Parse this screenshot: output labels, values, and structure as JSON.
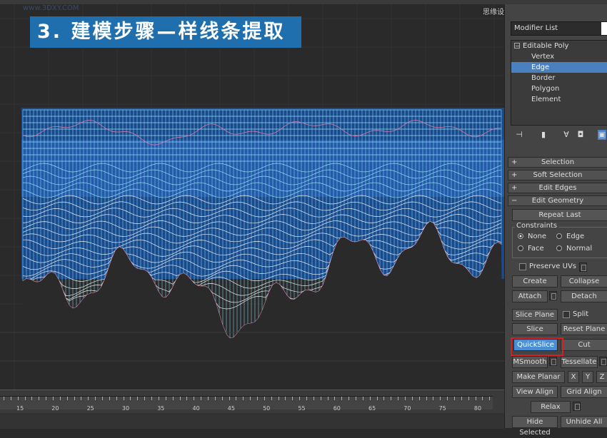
{
  "title_banner": "3. 建模步骤—样线条提取",
  "watermark_left": "www.3DXY.COM",
  "watermark_right": "思缘设计论坛 www.MISSYUAN.COM",
  "timeline": {
    "labels": [
      "15",
      "20",
      "25",
      "30",
      "35",
      "40",
      "45",
      "50",
      "55",
      "60",
      "65",
      "70",
      "75",
      "80"
    ]
  },
  "panel": {
    "modifier_list": "Modifier List",
    "stack": {
      "editable_poly": "Editable Poly",
      "vertex": "Vertex",
      "edge": "Edge",
      "border": "Border",
      "polygon": "Polygon",
      "element": "Element"
    },
    "rollouts": {
      "selection": "Selection",
      "soft_selection": "Soft Selection",
      "edit_edges": "Edit Edges",
      "edit_geometry": "Edit Geometry"
    },
    "repeat_last": "Repeat Last",
    "constraints": "Constraints",
    "none": "None",
    "edge": "Edge",
    "face": "Face",
    "normal": "Normal",
    "preserve_uvs": "Preserve UVs",
    "create": "Create",
    "collapse": "Collapse",
    "attach": "Attach",
    "detach": "Detach",
    "slice_plane": "Slice Plane",
    "split": "Split",
    "slice": "Slice",
    "reset_plane": "Reset Plane",
    "quickslice": "QuickSlice",
    "cut": "Cut",
    "msmooth": "MSmooth",
    "tessellate": "Tessellate",
    "make_planar": "Make Planar",
    "x": "X",
    "y": "Y",
    "z": "Z",
    "view_align": "View Align",
    "grid_align": "Grid Align",
    "relax": "Relax",
    "hide_selected": "Hide Selected",
    "unhide_all": "Unhide All"
  }
}
